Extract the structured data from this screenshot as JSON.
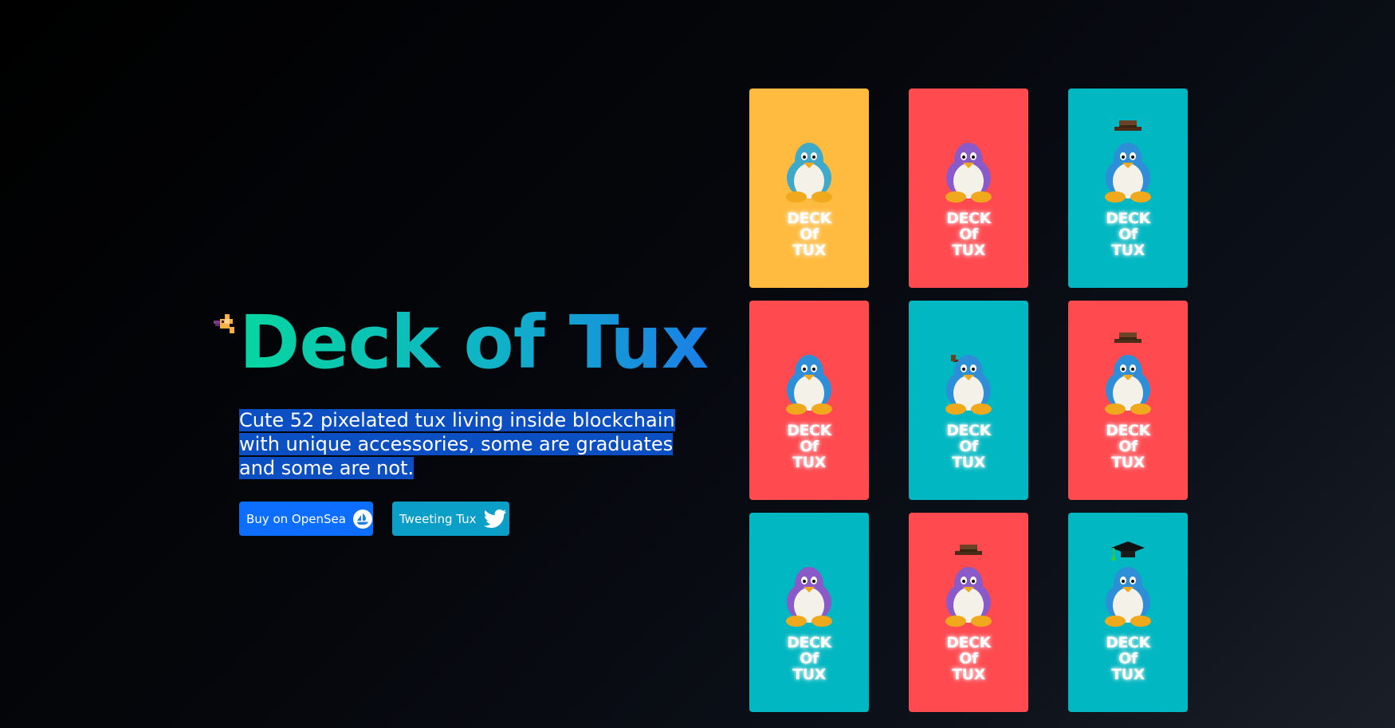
{
  "hero": {
    "title": "Deck of Tux",
    "description": "Cute 52 pixelated tux living inside blockchain with unique accessories, some are graduates and some are not.",
    "rocket_icon": "rocket-icon"
  },
  "buttons": {
    "opensea_label": "Buy on OpenSea",
    "opensea_icon": "opensea-icon",
    "twitter_label": "Tweeting Tux",
    "twitter_icon": "twitter-icon"
  },
  "cards": [
    {
      "bg": "#ffbb3f",
      "body": "#3fa9c9",
      "hat": "none",
      "line1": "DECK",
      "line2": "Of",
      "line3": "TUX"
    },
    {
      "bg": "#ff4a50",
      "body": "#8a5ac8",
      "hat": "none",
      "line1": "DECK",
      "line2": "Of",
      "line3": "TUX"
    },
    {
      "bg": "#00b7c2",
      "body": "#2e8fd8",
      "hat": "cowboy",
      "line1": "DECK",
      "line2": "Of",
      "line3": "TUX"
    },
    {
      "bg": "#ff4a50",
      "body": "#2e8fd8",
      "hat": "none",
      "line1": "DECK",
      "line2": "Of",
      "line3": "TUX"
    },
    {
      "bg": "#00b7c2",
      "body": "#2e8fd8",
      "hat": "pipe",
      "line1": "DECK",
      "line2": "Of",
      "line3": "TUX"
    },
    {
      "bg": "#ff4a50",
      "body": "#2e8fd8",
      "hat": "cowboy",
      "line1": "DECK",
      "line2": "Of",
      "line3": "TUX"
    },
    {
      "bg": "#00b7c2",
      "body": "#8a5ac8",
      "hat": "none",
      "line1": "DECK",
      "line2": "Of",
      "line3": "TUX"
    },
    {
      "bg": "#ff4a50",
      "body": "#8a5ac8",
      "hat": "cowboy",
      "line1": "DECK",
      "line2": "Of",
      "line3": "TUX"
    },
    {
      "bg": "#00b7c2",
      "body": "#2e8fd8",
      "hat": "graduation",
      "line1": "DECK",
      "line2": "Of",
      "line3": "TUX"
    }
  ],
  "colors": {
    "title_gradient_start": "#06d6a0",
    "title_gradient_end": "#1b7fe6",
    "opensea_button": "#0d6efd",
    "twitter_button": "#0b9ec7",
    "selection_highlight": "#0b4fc2"
  }
}
